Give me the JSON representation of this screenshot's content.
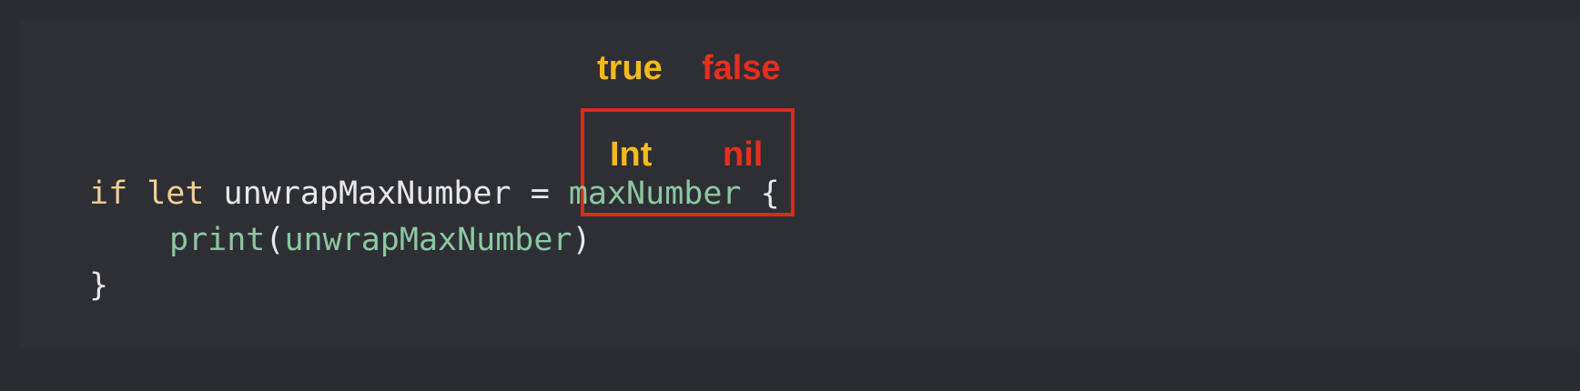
{
  "labels": {
    "true_label": "true",
    "false_label": "false",
    "int_label": "Int",
    "nil_label": "nil"
  },
  "code": {
    "line1": {
      "if_kw": "if",
      "let_kw": "let",
      "binding": "unwrapMaxNumber",
      "equals": "=",
      "optional_var": "maxNumber",
      "brace_open": "{"
    },
    "line2": {
      "print_fn": "print",
      "paren_open": "(",
      "arg": "unwrapMaxNumber",
      "paren_close": ")"
    },
    "line3": {
      "brace_close": "}"
    }
  },
  "colors": {
    "background": "#2b2c31",
    "true_color": "#f5b91c",
    "false_color": "#e62e1c",
    "keyword": "#f2cf92",
    "identifier": "#8cc7a1",
    "highlight_border": "#d92b1a"
  }
}
